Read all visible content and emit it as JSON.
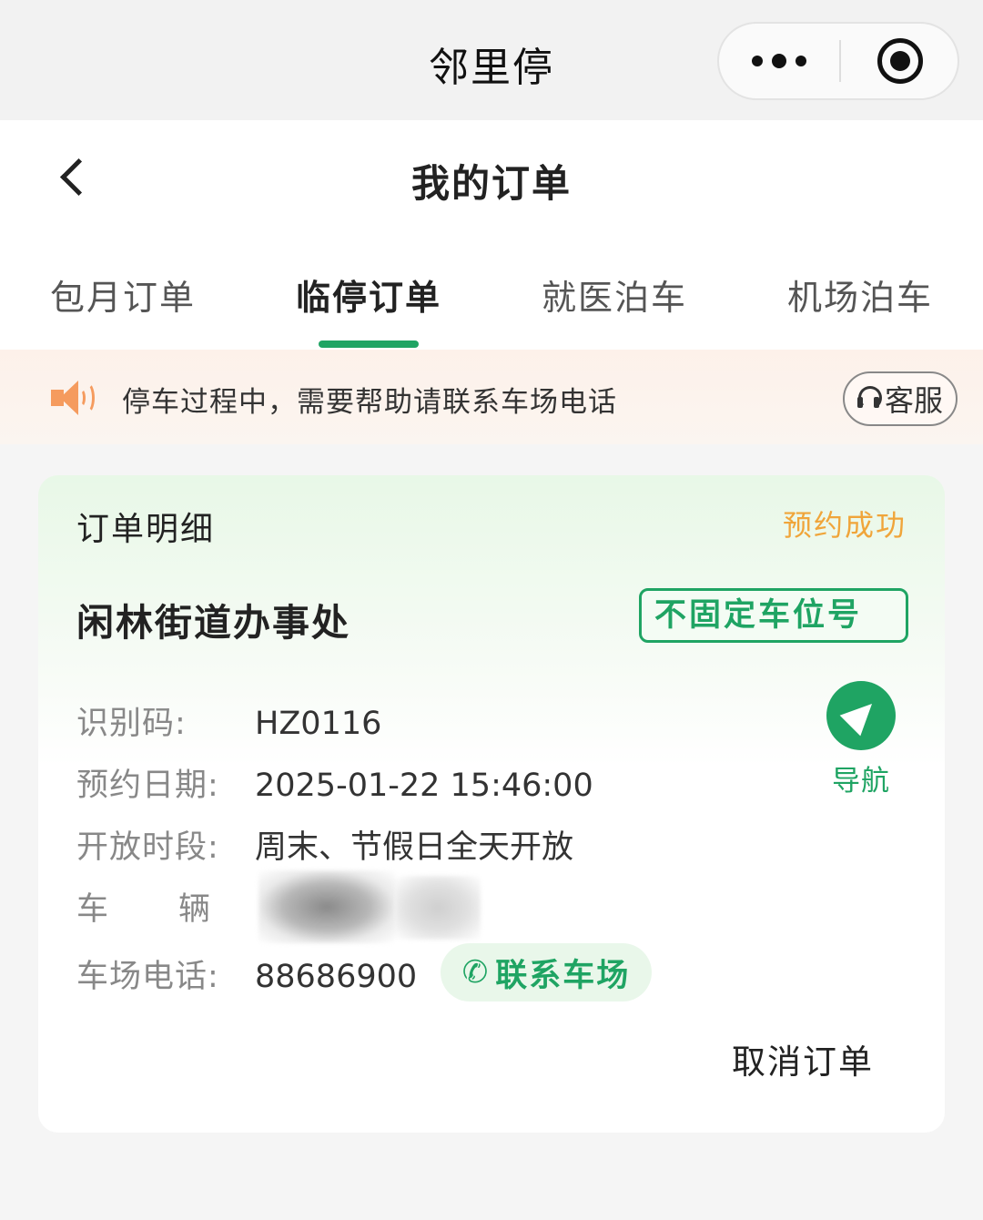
{
  "app": {
    "title": "邻里停"
  },
  "header": {
    "title": "我的订单"
  },
  "tabs": [
    {
      "label": "包月订单"
    },
    {
      "label": "临停订单",
      "active": true
    },
    {
      "label": "就医泊车"
    },
    {
      "label": "机场泊车"
    }
  ],
  "notice": {
    "text": "停车过程中，需要帮助请联系车场电话",
    "service_label": "客服"
  },
  "order": {
    "section_label": "订单明细",
    "status": "预约成功",
    "lot_name": "闲林街道办事处",
    "spot_type": "不固定车位号",
    "fields": {
      "code_label": "识别码:",
      "code_value": "HZ0116",
      "date_label": "预约日期:",
      "date_value": "2025-01-22 15:46:00",
      "hours_label": "开放时段:",
      "hours_value": "周末、节假日全天开放",
      "vehicle_label_a": "车",
      "vehicle_label_b": "辆",
      "phone_label": "车场电话:",
      "phone_value": "88686900"
    },
    "contact_label": "联系车场",
    "nav_label": "导航",
    "cancel_label": "取消订单"
  },
  "colors": {
    "accent": "#1fa463",
    "status": "#f0a53a",
    "notice_icon": "#f59b5e"
  },
  "icons": {
    "more": "more-dots-icon",
    "close": "target-close-icon",
    "back": "chevron-left-icon",
    "speaker": "speaker-icon",
    "headset": "headset-icon",
    "navigate": "navigation-arrow-icon",
    "phone": "phone-icon"
  }
}
